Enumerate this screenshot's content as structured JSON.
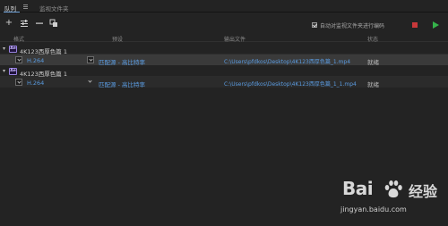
{
  "tabs": [
    {
      "label": "队列"
    },
    {
      "label": "监视文件夹"
    }
  ],
  "toolbar": {
    "add_icon": "plus-icon",
    "settings_icon": "source-settings-icon",
    "remove_icon": "minus-icon",
    "duplicate_icon": "duplicate-icon",
    "auto_encode_label": "自动对监视文件夹进行编码",
    "auto_encode_checked": true,
    "stop_color": "#c8383a",
    "start_color": "#35b34a"
  },
  "columns": {
    "format": "格式",
    "preset": "预设",
    "output": "输出文件",
    "status": "状态"
  },
  "queue": [
    {
      "source_badge": "Ae",
      "source_name": "4K123西厚色篇 1",
      "item": {
        "format": "H.264",
        "preset": "匹配源 - 高比特率",
        "output": "C:\\Users\\pfdkos\\Desktop\\4K123西厚色篇_1.mp4",
        "status": "就绪",
        "selected": true
      }
    },
    {
      "source_badge": "Ae",
      "source_name": "4K123西厚色篇 1",
      "item": {
        "format": "H.264",
        "preset": "匹配源 - 高比特率",
        "output": "C:\\Users\\pfdkos\\Desktop\\4K123西厚色篇_1_1.mp4",
        "status": "就绪",
        "selected": false
      }
    }
  ],
  "watermark": {
    "logo_text": "Bai",
    "logo_suffix": "经验",
    "url": "jingyan.baidu.com"
  }
}
